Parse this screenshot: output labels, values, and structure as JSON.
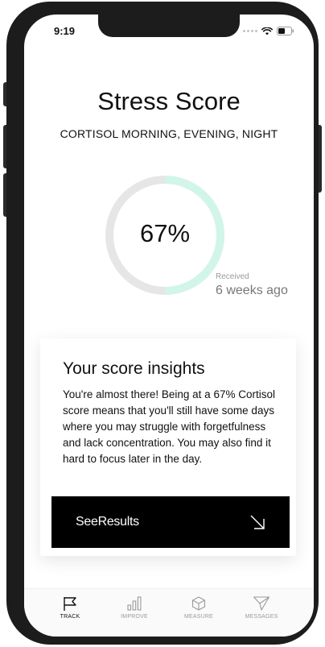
{
  "status_bar": {
    "time": "9:19"
  },
  "page": {
    "title": "Stress Score",
    "subtitle": "CORTISOL MORNING, EVENING, NIGHT"
  },
  "score": {
    "value_text": "67%",
    "progress_fraction": 0.5,
    "progress_color": "#d2f5ea",
    "track_color": "#e6e6e6",
    "received_label": "Received",
    "received_value": "6 weeks ago"
  },
  "insights": {
    "title": "Your score insights",
    "body": "You're almost there! Being at a 67% Cortisol score means that you'll still have some days where you may struggle with forgetfulness and lack concentration. You may also find it hard to focus later in the day.",
    "cta_label": "SeeResults",
    "cta_icon": "arrow-down-right-icon"
  },
  "tabs": [
    {
      "label": "TRACK",
      "icon": "flag-icon",
      "active": true
    },
    {
      "label": "IMPROVE",
      "icon": "bar-chart-icon",
      "active": false
    },
    {
      "label": "MEASURE",
      "icon": "cube-icon",
      "active": false
    },
    {
      "label": "MESSAGES",
      "icon": "send-icon",
      "active": false
    }
  ]
}
